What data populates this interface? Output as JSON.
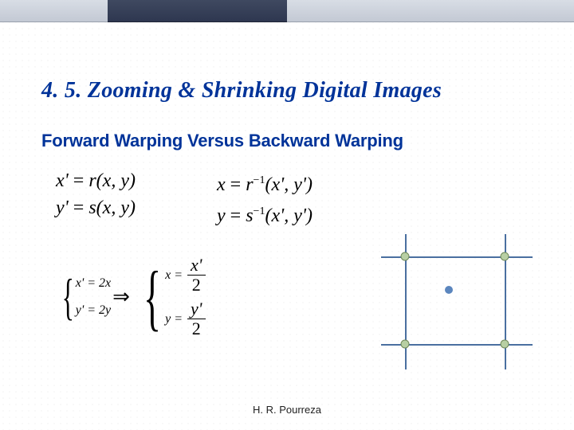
{
  "title": "4. 5. Zooming & Shrinking Digital Images",
  "subtitle": "Forward Warping Versus Backward Warping",
  "forward": {
    "eq1_lhs": "x'",
    "eq1_rhs": "r(x, y)",
    "eq2_lhs": "y'",
    "eq2_rhs": "s(x, y)"
  },
  "backward": {
    "eq1_lhs": "x",
    "eq1_fn": "r",
    "eq1_exp": "−1",
    "eq1_args": "(x', y')",
    "eq2_lhs": "y",
    "eq2_fn": "s",
    "eq2_exp": "−1",
    "eq2_args": "(x', y')"
  },
  "example_forward": {
    "eq1": "x' = 2x",
    "eq2": "y' = 2y"
  },
  "example_backward": {
    "eq1_lhs": "x =",
    "eq1_num": "x'",
    "eq1_den": "2",
    "eq2_lhs": "y =",
    "eq2_num": "y'",
    "eq2_den": "2"
  },
  "arrow": "⇒",
  "author": "H. R. Pourreza",
  "eq": "="
}
